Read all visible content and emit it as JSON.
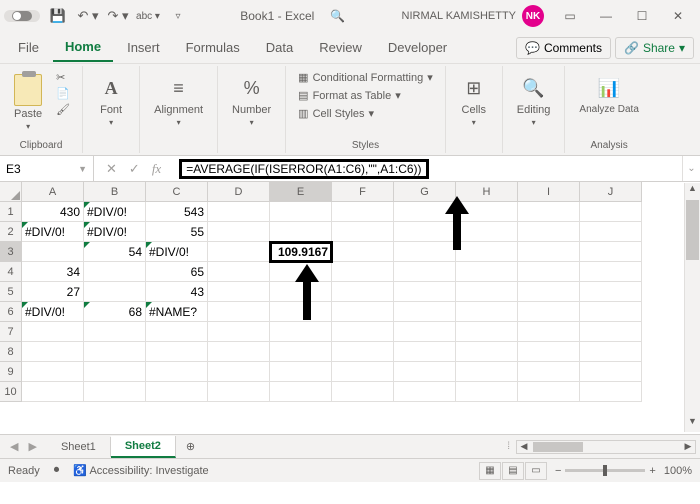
{
  "titlebar": {
    "autosave_label": "",
    "book_name": "Book1 - Excel",
    "search_placeholder": "",
    "user_name": "NIRMAL KAMISHETTY",
    "user_initials": "NK"
  },
  "tabs": {
    "file": "File",
    "home": "Home",
    "insert": "Insert",
    "formulas": "Formulas",
    "data": "Data",
    "review": "Review",
    "developer": "Developer",
    "comments": "Comments",
    "share": "Share"
  },
  "ribbon": {
    "clipboard": {
      "paste": "Paste",
      "label": "Clipboard"
    },
    "font": {
      "btn": "Font"
    },
    "alignment": {
      "btn": "Alignment"
    },
    "number": {
      "btn": "Number"
    },
    "styles": {
      "conditional": "Conditional Formatting",
      "table": "Format as Table",
      "cellstyles": "Cell Styles",
      "label": "Styles"
    },
    "cells": {
      "btn": "Cells"
    },
    "editing": {
      "btn": "Editing"
    },
    "analysis": {
      "btn": "Analyze Data",
      "label": "Analysis"
    }
  },
  "namebox": "E3",
  "formula": "=AVERAGE(IF(ISERROR(A1:C6),\"\",A1:C6))",
  "columns": [
    "A",
    "B",
    "C",
    "D",
    "E",
    "F",
    "G",
    "H",
    "I",
    "J"
  ],
  "rows": [
    "1",
    "2",
    "3",
    "4",
    "5",
    "6",
    "7",
    "8",
    "9",
    "10"
  ],
  "cells": {
    "A1": "430",
    "B1": "#DIV/0!",
    "C1": "543",
    "A2": "#DIV/0!",
    "B2": "#DIV/0!",
    "C2": "55",
    "B3": "54",
    "C3": "#DIV/0!",
    "E3": "109.9167",
    "A4": "34",
    "C4": "65",
    "A5": "27",
    "C5": "43",
    "A6": "#DIV/0!",
    "B6": "68",
    "C6": "#NAME?"
  },
  "sheets": {
    "s1": "Sheet1",
    "s2": "Sheet2"
  },
  "status": {
    "ready": "Ready",
    "accessibility": "Accessibility: Investigate",
    "zoom": "100%"
  }
}
